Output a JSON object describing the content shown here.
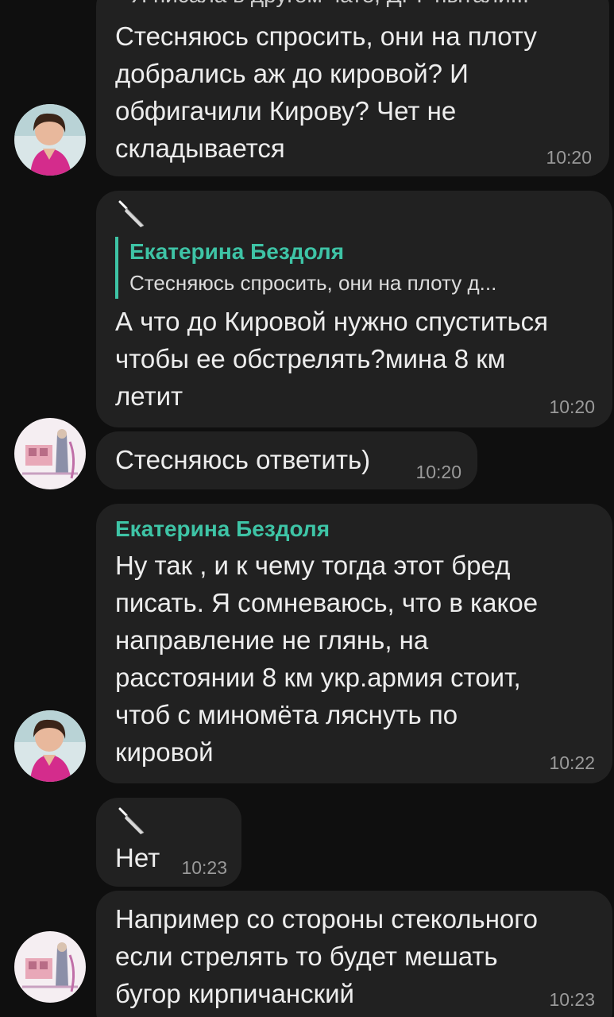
{
  "messages": [
    {
      "id": "m1",
      "reply_snippet": "Я писала в другом чате, ДРГ пытали...",
      "text": "Стесняюсь спросить, они на плоту\nдобрались аж до кировой? И\nобфигачили Кирову? Чет не\nскладывается",
      "time": "10:20"
    },
    {
      "id": "m2",
      "reply_to": {
        "name": "Екатерина Бездоля",
        "text": "Стесняюсь спросить, они на плоту д..."
      },
      "text": "А что до Кировой нужно спуститься\nчтобы ее обстрелять?мина 8 км\nлетит",
      "time": "10:20"
    },
    {
      "id": "m3",
      "text": "Стесняюсь ответить)",
      "time": "10:20"
    },
    {
      "id": "m4",
      "sender": "Екатерина Бездоля",
      "text": "Ну так , и к чему тогда этот бред\nписать. Я сомневаюсь, что в какое\nнаправление не глянь, на\nрасстоянии 8 км укр.армия стоит,\nчтоб с миномёта ляснуть по\nкировой",
      "time": "10:22"
    },
    {
      "id": "m5",
      "text": "Нет",
      "time": "10:23"
    },
    {
      "id": "m6",
      "text": "Например со стороны стекольного\nесли стрелять то будет мешать\nбугор кирпичанский",
      "time": "10:23"
    }
  ],
  "icons": {
    "sender_badge": "knife-icon",
    "avatar_woman": "avatar-woman-pink",
    "avatar_drawing": "avatar-drawing"
  },
  "colors": {
    "background": "#0f0f0f",
    "bubble": "#212121",
    "accent": "#3ec4a6",
    "time": "#9a9a9a"
  }
}
